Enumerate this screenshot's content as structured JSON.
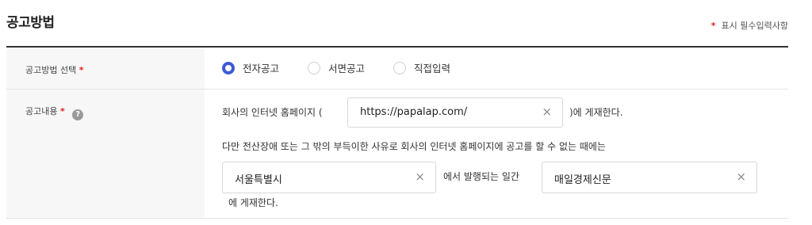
{
  "section": {
    "title": "공고방법",
    "required_note_mark": "*",
    "required_note_text": "표시 필수입력사항"
  },
  "method_row": {
    "label": "공고방법 선택",
    "required_mark": "*",
    "options": [
      {
        "label": "전자공고",
        "selected": true
      },
      {
        "label": "서면공고",
        "selected": false
      },
      {
        "label": "직접입력",
        "selected": false
      }
    ]
  },
  "content_row": {
    "label": "공고내용",
    "required_mark": "*",
    "help_icon": "?",
    "line1_prefix": "회사의 인터넷 홈페이지 (",
    "homepage_url": "https://papalap.com/",
    "line1_suffix": ")에 게재한다.",
    "line2": "다만 전산장애 또는 그 밖의 부득이한 사유로 회사의 인터넷 홈페이지에 공고를 할 수 없는 때에는",
    "region_value": "서울특별시",
    "line3_mid": "에서 발행되는 일간",
    "newspaper_value": "매일경제신문",
    "line4": "에 게재한다."
  },
  "clear_icon": "×"
}
